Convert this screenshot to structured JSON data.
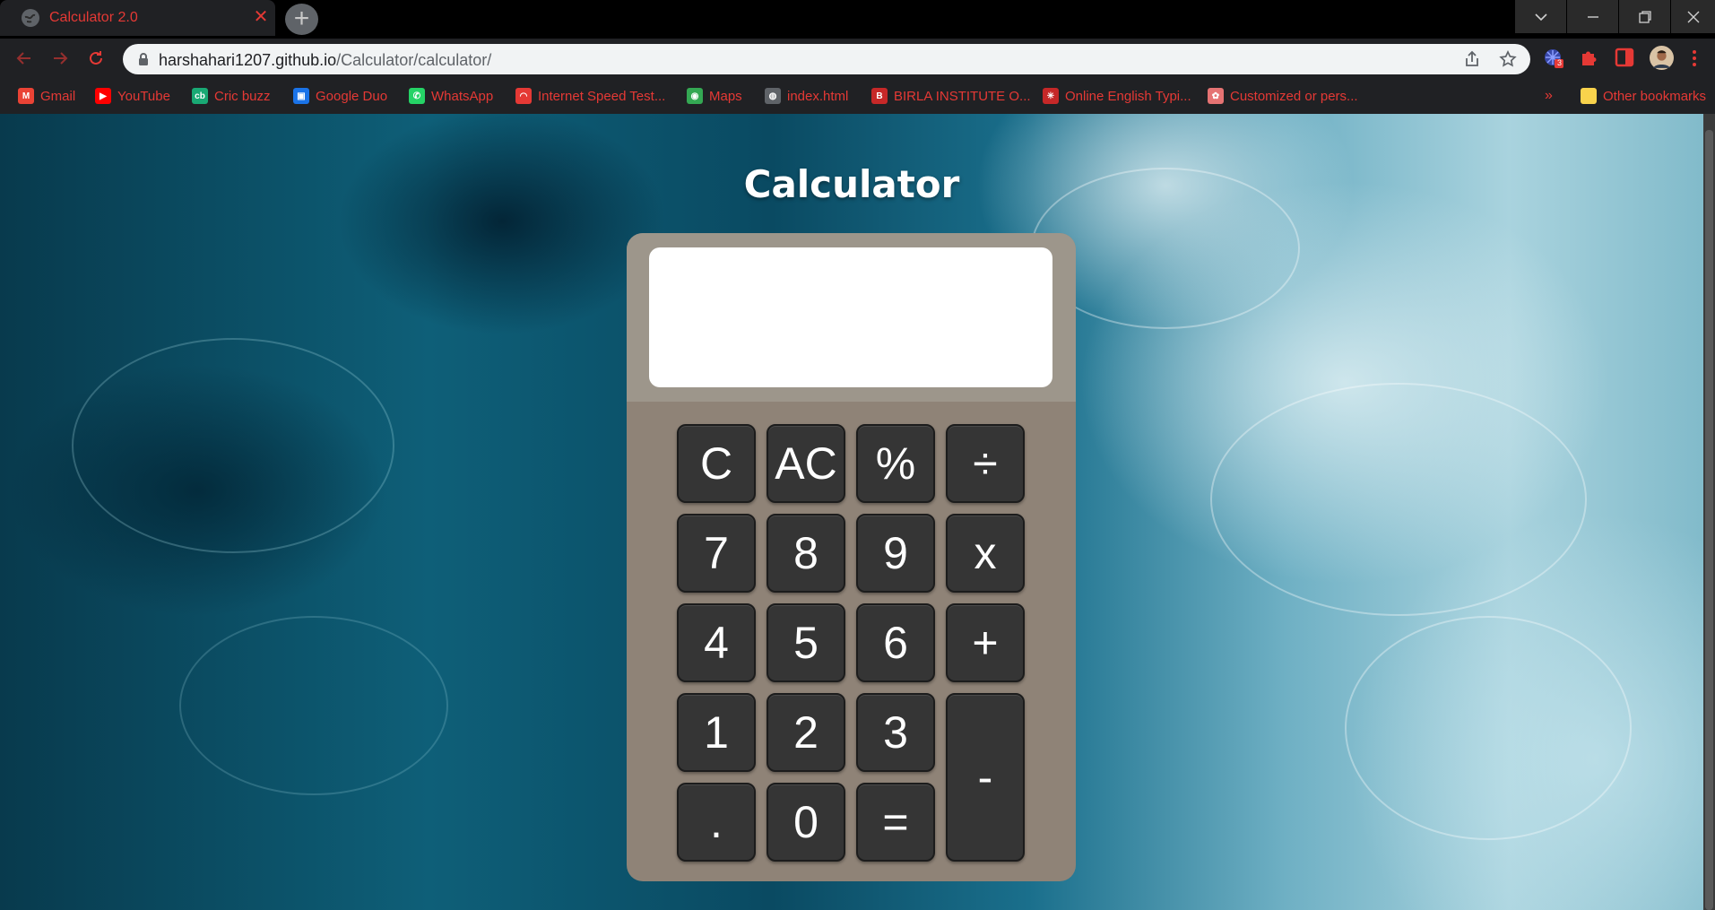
{
  "browser": {
    "tab": {
      "title": "Calculator 2.0",
      "close_glyph": "✕"
    },
    "new_tab_glyph": "+",
    "url": {
      "host": "harshahari1207.github.io",
      "path": "/Calculator/calculator/"
    },
    "extension_badge": "3"
  },
  "bookmarks": [
    {
      "label": "Gmail",
      "icon": "gmail-icon",
      "color": "#ea4335",
      "glyph": "M"
    },
    {
      "label": "YouTube",
      "icon": "youtube-icon",
      "color": "#ff0000",
      "glyph": "▶"
    },
    {
      "label": "Cric buzz",
      "icon": "cricbuzz-icon",
      "color": "#19a974",
      "glyph": "cb"
    },
    {
      "label": "Google Duo",
      "icon": "google-duo-icon",
      "color": "#1a73e8",
      "glyph": "▣"
    },
    {
      "label": "WhatsApp",
      "icon": "whatsapp-icon",
      "color": "#25d366",
      "glyph": "✆"
    },
    {
      "label": "Internet Speed Test...",
      "icon": "speedtest-icon",
      "color": "#e53935",
      "glyph": "◠"
    },
    {
      "label": "Maps",
      "icon": "maps-icon",
      "color": "#34a853",
      "glyph": "◉"
    },
    {
      "label": "index.html",
      "icon": "globe-icon",
      "color": "#5f6368",
      "glyph": "◍"
    },
    {
      "label": "BIRLA INSTITUTE O...",
      "icon": "bits-icon",
      "color": "#c62828",
      "glyph": "B"
    },
    {
      "label": "Online English Typi...",
      "icon": "typing-icon",
      "color": "#c62828",
      "glyph": "✳"
    },
    {
      "label": "Customized or pers...",
      "icon": "gift-icon",
      "color": "#e57373",
      "glyph": "✿"
    }
  ],
  "bookmarks_overflow": "»",
  "other_bookmarks": "Other bookmarks",
  "page": {
    "title": "Calculator",
    "display_value": "",
    "keys": [
      {
        "label": "C",
        "name": "key-clear"
      },
      {
        "label": "AC",
        "name": "key-all-clear"
      },
      {
        "label": "%",
        "name": "key-percent"
      },
      {
        "label": "÷",
        "name": "key-divide"
      },
      {
        "label": "7",
        "name": "key-7"
      },
      {
        "label": "8",
        "name": "key-8"
      },
      {
        "label": "9",
        "name": "key-9"
      },
      {
        "label": "x",
        "name": "key-multiply"
      },
      {
        "label": "4",
        "name": "key-4"
      },
      {
        "label": "5",
        "name": "key-5"
      },
      {
        "label": "6",
        "name": "key-6"
      },
      {
        "label": "+",
        "name": "key-plus"
      },
      {
        "label": "1",
        "name": "key-1"
      },
      {
        "label": "2",
        "name": "key-2"
      },
      {
        "label": "3",
        "name": "key-3"
      },
      {
        "label": "-",
        "name": "key-minus"
      },
      {
        "label": ".",
        "name": "key-decimal"
      },
      {
        "label": "0",
        "name": "key-0"
      },
      {
        "label": "=",
        "name": "key-equals"
      }
    ]
  }
}
